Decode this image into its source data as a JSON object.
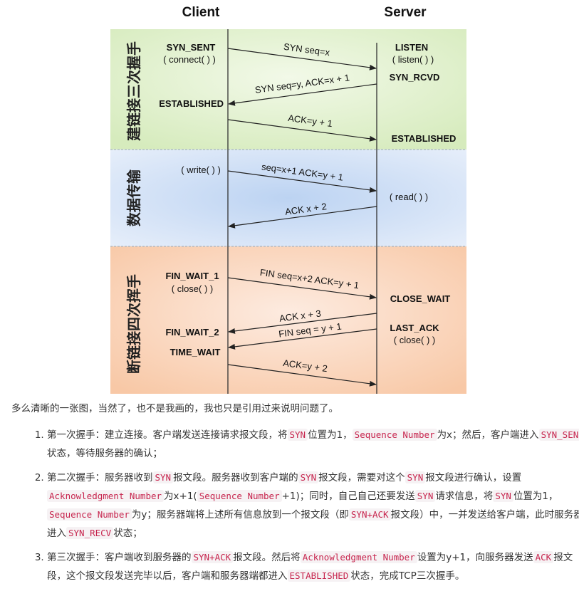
{
  "diagram": {
    "client_title": "Client",
    "server_title": "Server",
    "band_labels": {
      "handshake": "建链接三次握手",
      "transfer": "数据传输",
      "teardown": "断链接四次挥手"
    },
    "client_states": {
      "syn_sent": "SYN_SENT",
      "connect": "( connect( ) )",
      "established": "ESTABLISHED",
      "write": "( write( ) )",
      "fin_wait_1": "FIN_WAIT_1",
      "close": "( close( ) )",
      "fin_wait_2": "FIN_WAIT_2",
      "time_wait": "TIME_WAIT"
    },
    "server_states": {
      "listen": "LISTEN",
      "listen_call": "( listen( ) )",
      "syn_rcvd": "SYN_RCVD",
      "established": "ESTABLISHED",
      "read": "( read( ) )",
      "close_wait": "CLOSE_WAIT",
      "last_ack": "LAST_ACK",
      "close": "( close( ) )"
    },
    "messages": {
      "m1": "SYN seq=x",
      "m2": "SYN seq=y, ACK=x + 1",
      "m3": "ACK=y + 1",
      "m4": "seq=x+1 ACK=y + 1",
      "m5": "ACK x + 2",
      "m6": "FIN seq=x+2 ACK=y + 1",
      "m7": "ACK x + 3",
      "m8": "FIN seq = y + 1",
      "m9": "ACK=y + 2"
    },
    "colors": {
      "handshake_band": "#e3f1d0",
      "transfer_band": "#d8e4f5",
      "teardown_band": "#fbdcc6"
    }
  },
  "caption": "多么清晰的一张图，当然了，也不是我画的，我也只是引用过来说明问题了。",
  "steps": [
    {
      "t1": "第一次握手：建立连接。客户端发送连接请求报文段，将",
      "c1": "SYN",
      "t2": "位置为1，",
      "c2": "Sequence Number",
      "t3": "为x；然后，客户端进入",
      "c3": "SYN_SEND",
      "t4": "状态，等待服务器的确认；"
    },
    {
      "t1": "第二次握手：服务器收到",
      "c1": "SYN",
      "t2": "报文段。服务器收到客户端的",
      "c2": "SYN",
      "t3": "报文段，需要对这个",
      "c3": "SYN",
      "t4": "报文段进行确认，设置",
      "c4": "Acknowledgment Number",
      "t5": "为x+1(",
      "c5": "Sequence Number",
      "t6": "+1)；同时，自己自己还要发送",
      "c6": "SYN",
      "t7": "请求信息，将",
      "c7": "SYN",
      "t8": "位置为1，",
      "c8": "Sequence Number",
      "t9": "为y；服务器端将上述所有信息放到一个报文段（即",
      "c9": "SYN+ACK",
      "t10": "报文段）中，一并发送给客户端，此时服务器进入",
      "c10": "SYN_RECV",
      "t11": "状态；"
    },
    {
      "t1": "第三次握手：客户端收到服务器的",
      "c1": "SYN+ACK",
      "t2": "报文段。然后将",
      "c2": "Acknowledgment Number",
      "t3": "设置为y+1，向服务器发送",
      "c3": "ACK",
      "t4": "报文段，这个报文段发送完毕以后，客户端和服务器端都进入",
      "c4": "ESTABLISHED",
      "t5": "状态，完成TCP三次握手。"
    }
  ]
}
